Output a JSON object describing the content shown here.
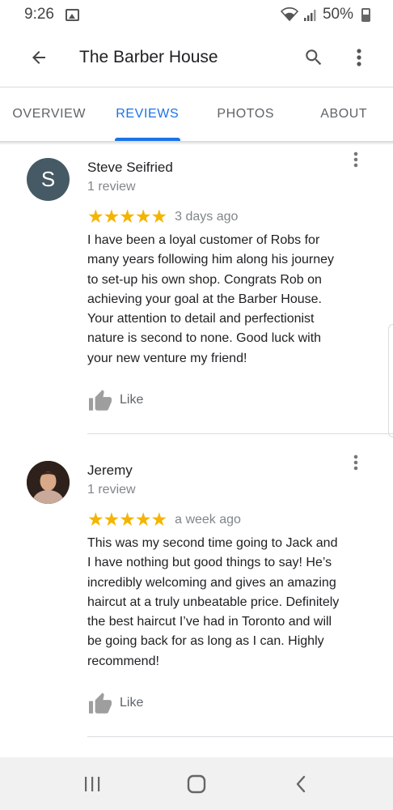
{
  "status_bar": {
    "time": "9:26",
    "battery": "50%",
    "icons": [
      "gallery-icon",
      "wifi-icon",
      "signal-icon",
      "battery-icon"
    ]
  },
  "app_bar": {
    "title": "The Barber House",
    "icons": [
      "back-arrow-icon",
      "search-icon",
      "more-vert-icon"
    ]
  },
  "tabs": [
    {
      "label": "OVERVIEW",
      "active": false
    },
    {
      "label": "REVIEWS",
      "active": true
    },
    {
      "label": "PHOTOS",
      "active": false
    },
    {
      "label": "ABOUT",
      "active": false
    }
  ],
  "reviews": [
    {
      "avatar_letter": "S",
      "name": "Steve Seifried",
      "review_count": "1 review",
      "rating": 5,
      "stars": "★★★★★",
      "date": "3 days ago",
      "lines": [
        "I have been a loyal customer of Robs for",
        "many years following him along his journey",
        "to set-up his own shop. Congrats Rob on",
        "achieving your goal at the Barber House.",
        "Your attention to detail and perfectionist",
        "nature is second to none. Good luck with",
        "your new venture my friend!"
      ],
      "like_label": "Like"
    },
    {
      "avatar_letter": "",
      "name": "Jeremy",
      "review_count": "1 review",
      "rating": 5,
      "stars": "★★★★★",
      "date": "a week ago",
      "lines": [
        "This was my second time going to Jack and",
        "I have nothing but good things to say! He’s",
        "incredibly welcoming and gives an amazing",
        "haircut at a truly unbeatable price. Definitely",
        "the best haircut I’ve had in Toronto and will",
        "be going back for as long as I can. Highly",
        "recommend!"
      ],
      "like_label": "Like"
    }
  ],
  "nav_bar": {
    "icons": [
      "recent-apps-icon",
      "home-icon",
      "back-icon"
    ]
  },
  "colors": {
    "accent": "#1a73e8",
    "star": "#f4b400",
    "avatar_bg": "#455a64"
  }
}
